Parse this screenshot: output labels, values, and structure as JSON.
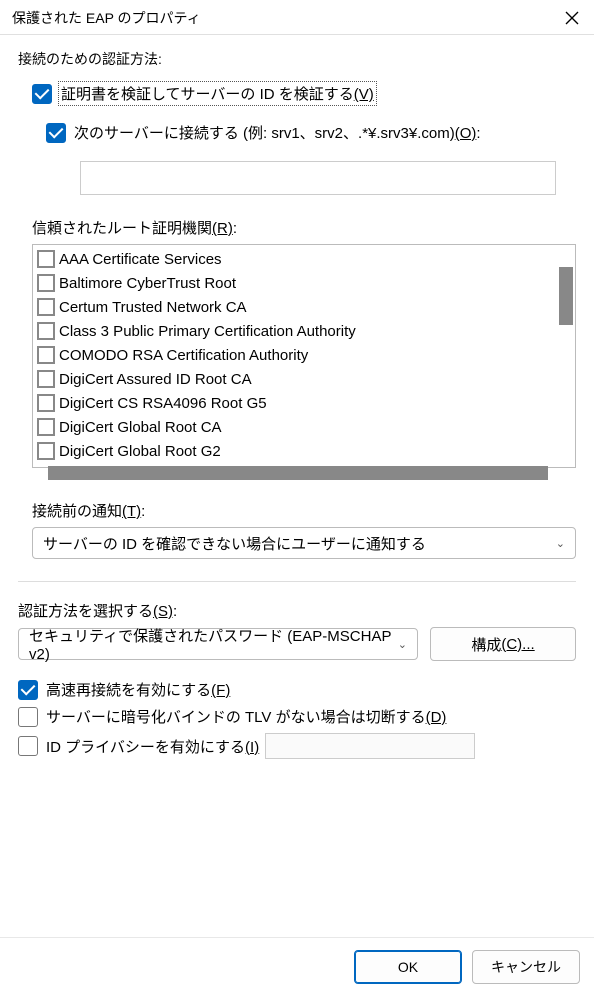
{
  "title": "保護された EAP のプロパティ",
  "section_auth_method": "接続のための認証方法:",
  "verify_server": {
    "checked": true,
    "label": "証明書を検証してサーバーの ID を検証する",
    "accel": "(V)"
  },
  "connect_servers": {
    "checked": true,
    "label": "次のサーバーに接続する (例: srv1、srv2、.*¥.srv3¥.com)",
    "accel": "(O)",
    "value": ""
  },
  "trusted_ca": {
    "label": "信頼されたルート証明機関",
    "accel": "(R)",
    "items": [
      "AAA Certificate Services",
      "Baltimore CyberTrust Root",
      "Certum Trusted Network CA",
      "Class 3 Public Primary Certification Authority",
      "COMODO RSA Certification Authority",
      "DigiCert Assured ID Root CA",
      "DigiCert CS RSA4096 Root G5",
      "DigiCert Global Root CA",
      "DigiCert Global Root G2"
    ]
  },
  "pre_notify": {
    "label": "接続前の通知",
    "accel": "(T)",
    "value": "サーバーの ID を確認できない場合にユーザーに通知する"
  },
  "auth_select": {
    "label": "認証方法を選択する",
    "accel": "(S)",
    "value": "セキュリティで保護されたパスワード (EAP-MSCHAP v2)",
    "configure": "構成",
    "configure_accel": "(C)..."
  },
  "options": {
    "fast_reconnect": {
      "checked": true,
      "label": "高速再接続を有効にする",
      "accel": "(F)"
    },
    "disconnect_no_tlv": {
      "checked": false,
      "label": "サーバーに暗号化バインドの TLV がない場合は切断する",
      "accel": "(D)"
    },
    "id_privacy": {
      "checked": false,
      "label": "ID プライバシーを有効にする",
      "accel": "(I)",
      "value": ""
    }
  },
  "buttons": {
    "ok": "OK",
    "cancel": "キャンセル"
  }
}
